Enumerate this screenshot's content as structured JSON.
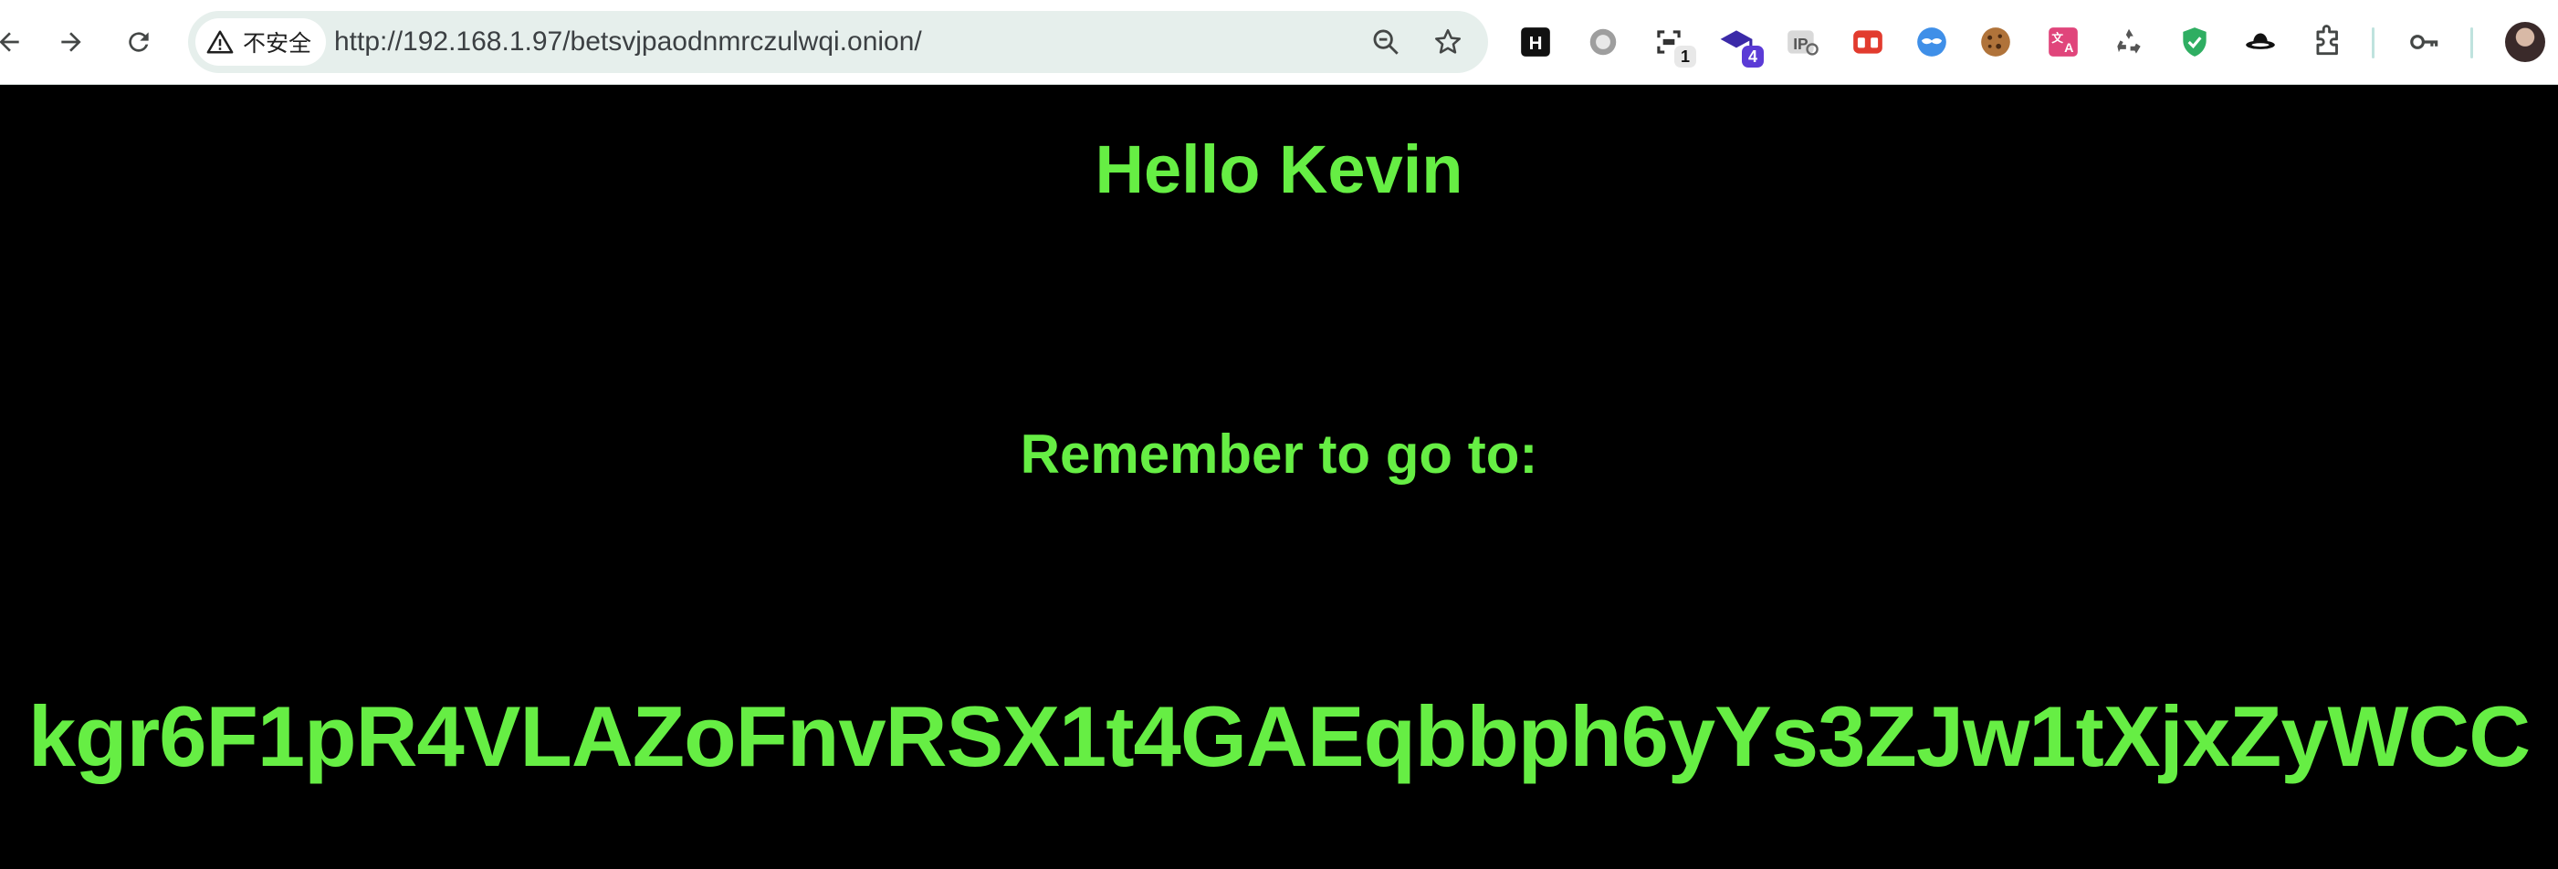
{
  "browser": {
    "security_label": "不安全",
    "url": "http://192.168.1.97/betsvjpaodnmrczulwqi.onion/",
    "extensions": [
      {
        "name": "hackerone-icon",
        "badge": ""
      },
      {
        "name": "circle-extension-icon",
        "badge": ""
      },
      {
        "name": "scan-extension-icon",
        "badge": "1"
      },
      {
        "name": "graduation-cap-extension-icon",
        "badge": "4"
      },
      {
        "name": "ip-extension-icon",
        "badge": ""
      },
      {
        "name": "red-game-extension-icon",
        "badge": ""
      },
      {
        "name": "mask-extension-icon",
        "badge": ""
      },
      {
        "name": "cookie-extension-icon",
        "badge": ""
      },
      {
        "name": "translate-extension-icon",
        "badge": ""
      },
      {
        "name": "recycle-extension-icon",
        "badge": ""
      },
      {
        "name": "shield-check-extension-icon",
        "badge": ""
      },
      {
        "name": "hat-extension-icon",
        "badge": ""
      },
      {
        "name": "puzzle-extensions-icon",
        "badge": ""
      },
      {
        "name": "key-icon",
        "badge": ""
      }
    ],
    "colors": {
      "omnibox_bg": "#e6efec",
      "badge_blue": "#5b3bd6"
    }
  },
  "page": {
    "greeting": "Hello Kevin",
    "instruction": "Remember to go to:",
    "code": "kgr6F1pR4VLAZoFnvRSX1t4GAEqbbph6yYs3ZJw1tXjxZyWCC",
    "text_color": "#66ee44",
    "background": "#000000"
  }
}
